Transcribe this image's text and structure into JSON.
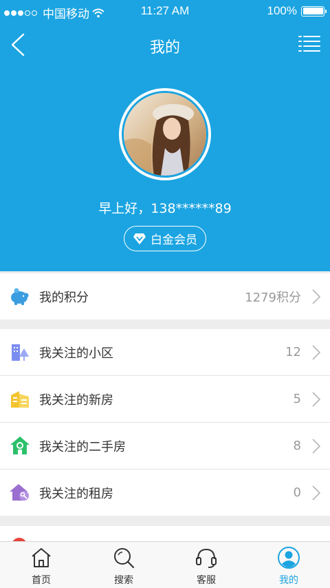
{
  "status_bar": {
    "carrier": "中国移动",
    "time": "11:27 AM",
    "battery": "100%"
  },
  "nav": {
    "title": "我的",
    "back_icon": "chevron-left-icon",
    "menu_icon": "list-menu-icon"
  },
  "profile": {
    "greeting": "早上好，138******89",
    "membership": "白金会员"
  },
  "points": {
    "label": "我的积分",
    "value": "1279积分"
  },
  "follows": [
    {
      "label": "我关注的小区",
      "count": "12",
      "color": "#7b8ef0"
    },
    {
      "label": "我关注的新房",
      "count": "5",
      "color": "#f4c430"
    },
    {
      "label": "我关注的二手房",
      "count": "8",
      "color": "#2dbf6b"
    },
    {
      "label": "我关注的租房",
      "count": "0",
      "color": "#9b6fd0"
    }
  ],
  "tabs": [
    {
      "label": "首页",
      "icon": "home-icon"
    },
    {
      "label": "搜索",
      "icon": "search-icon"
    },
    {
      "label": "客服",
      "icon": "headset-icon"
    },
    {
      "label": "我的",
      "icon": "user-icon",
      "active": true
    }
  ],
  "colors": {
    "primary": "#1ba4e1",
    "background": "#ededed"
  }
}
